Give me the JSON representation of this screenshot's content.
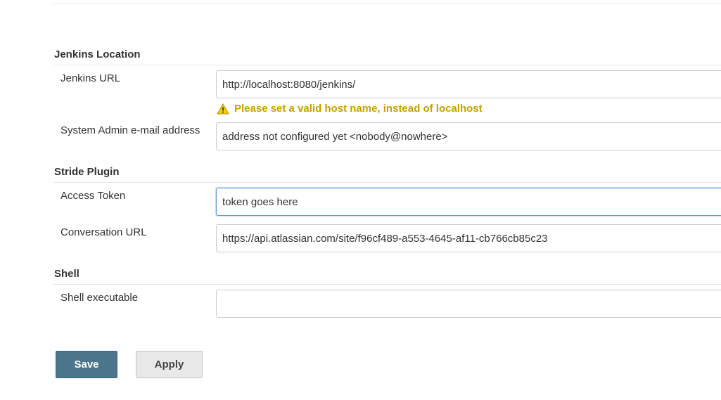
{
  "sections": {
    "jenkins_location": {
      "title": "Jenkins Location",
      "url_label": "Jenkins URL",
      "url_value": "http://localhost:8080/jenkins/",
      "url_warning": "Please set a valid host name, instead of localhost",
      "email_label": "System Admin e-mail address",
      "email_value": "address not configured yet <nobody@nowhere>"
    },
    "stride_plugin": {
      "title": "Stride Plugin",
      "token_label": "Access Token",
      "token_value": "token goes here",
      "conversation_label": "Conversation URL",
      "conversation_value": "https://api.atlassian.com/site/f96cf489-a553-4645-af11-cb766cb85c23"
    },
    "shell": {
      "title": "Shell",
      "executable_label": "Shell executable",
      "executable_value": ""
    }
  },
  "buttons": {
    "save_label": "Save",
    "apply_label": "Apply"
  },
  "icons": {
    "warning": "warning-icon"
  },
  "colors": {
    "save_bg": "#4b758b",
    "warning_text": "#c4a000",
    "focus_border": "#5b9bd5"
  }
}
